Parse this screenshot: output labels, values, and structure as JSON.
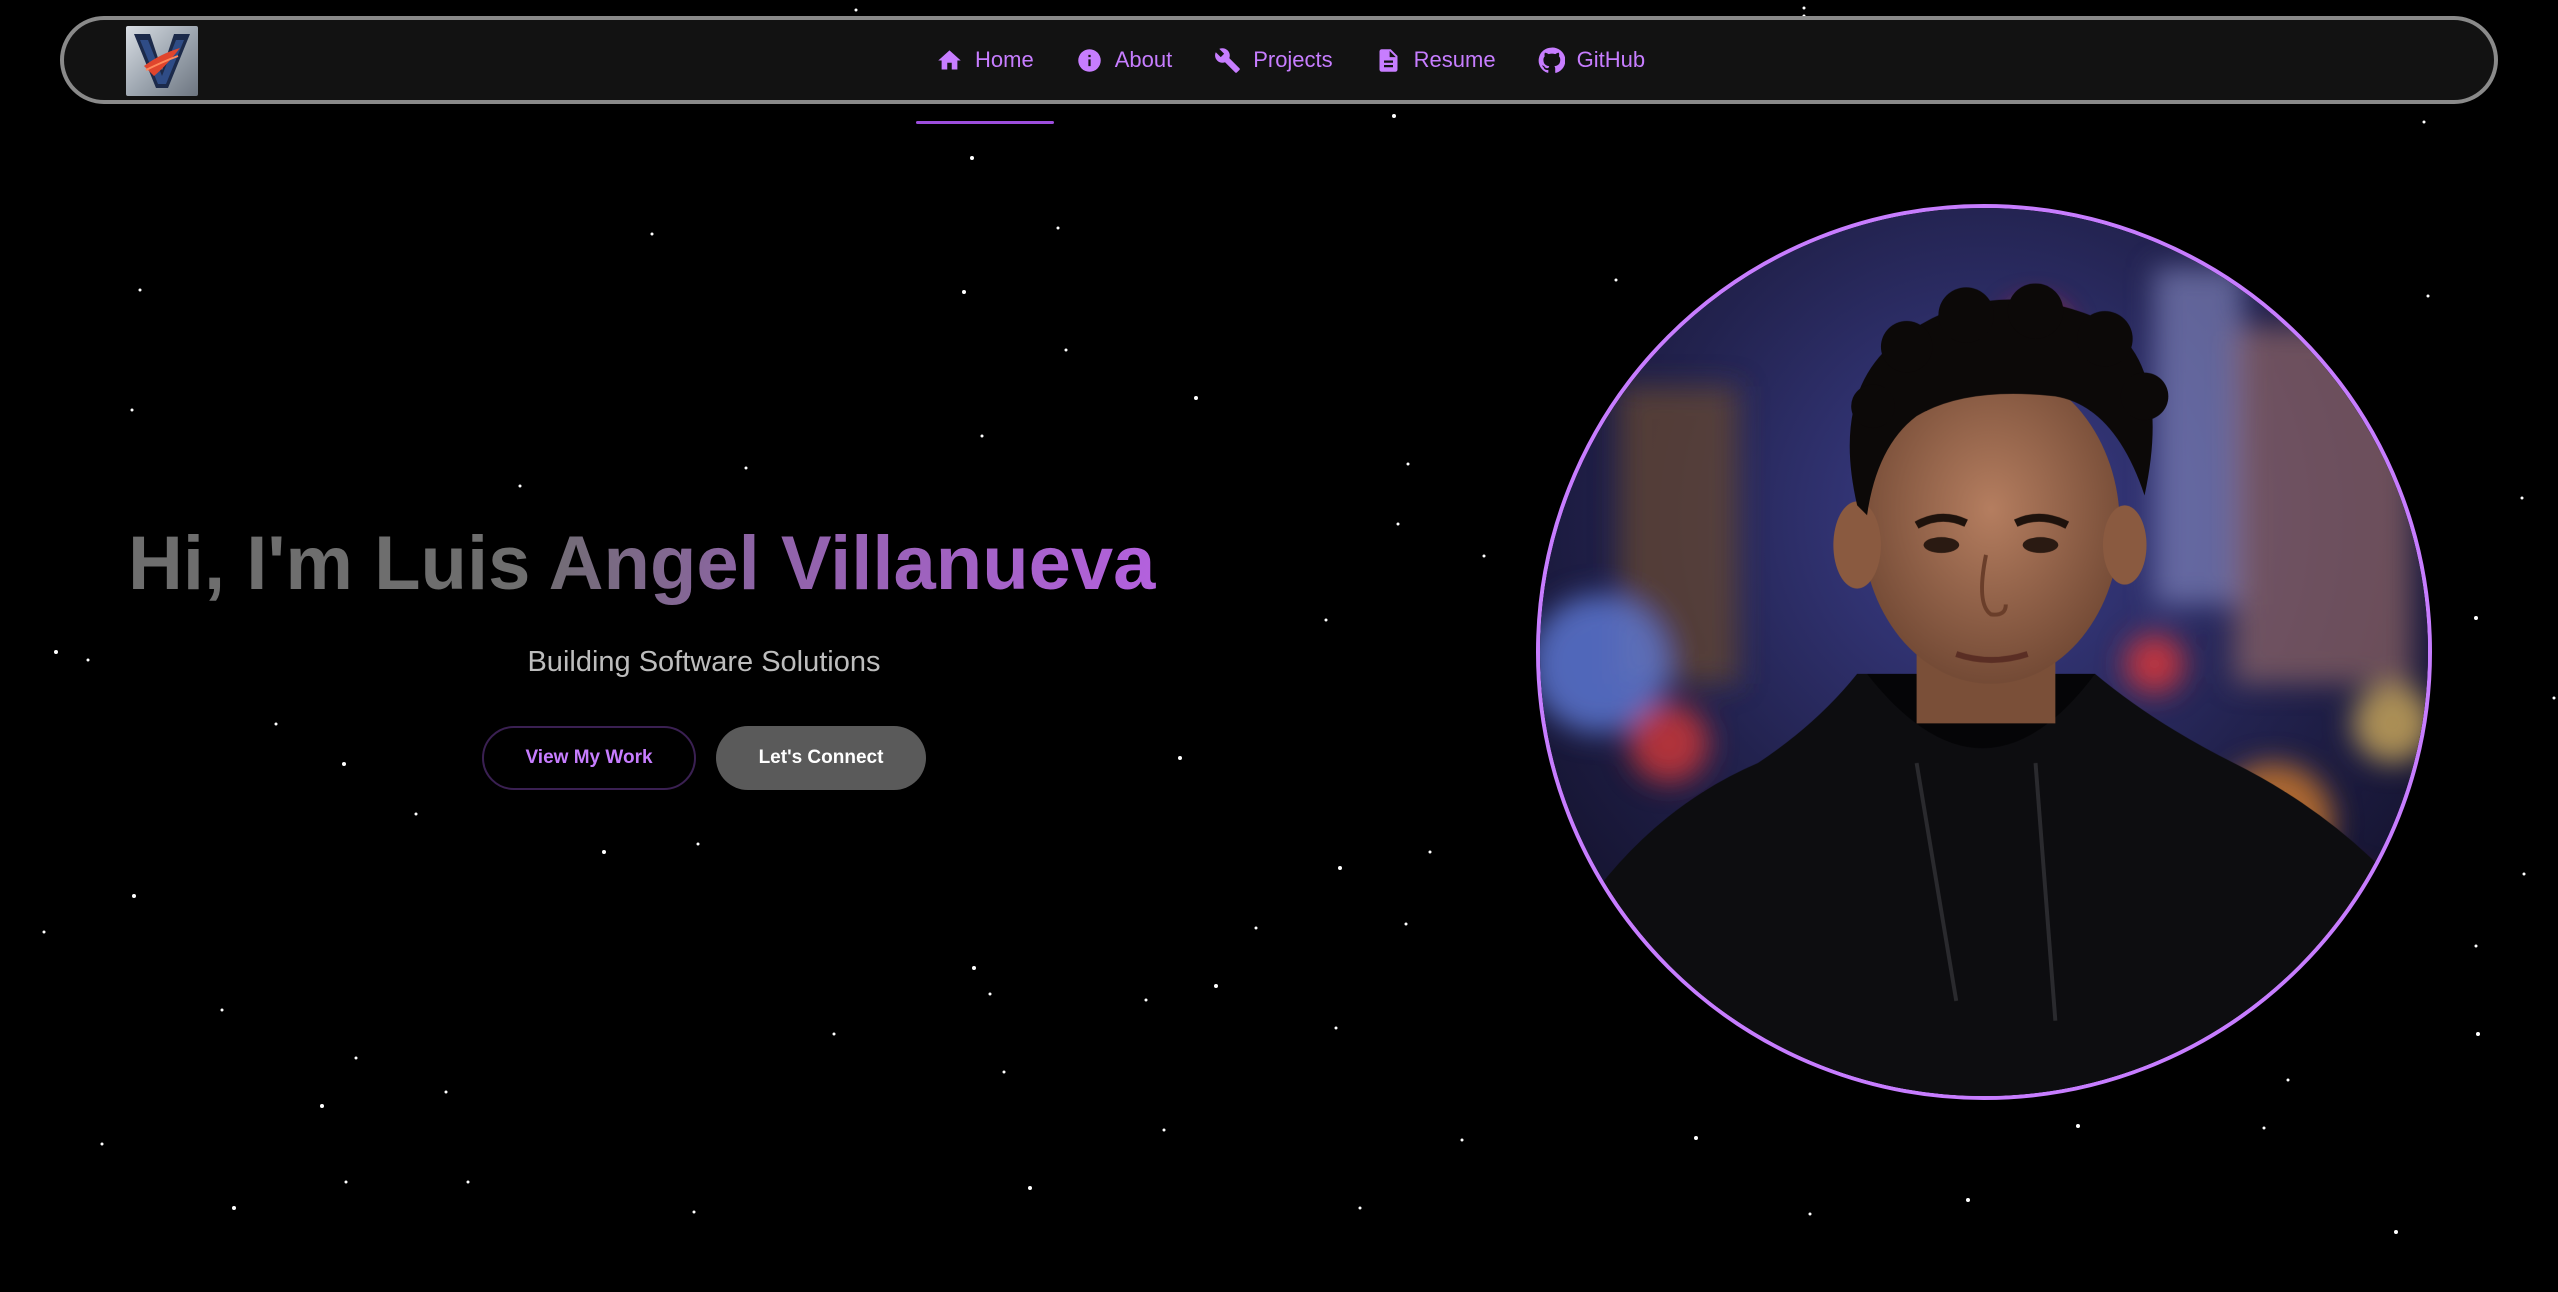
{
  "navbar": {
    "items": [
      {
        "label": "Home",
        "icon": "home-icon",
        "active": true
      },
      {
        "label": "About",
        "icon": "info-icon",
        "active": false
      },
      {
        "label": "Projects",
        "icon": "wrench-icon",
        "active": false
      },
      {
        "label": "Resume",
        "icon": "document-icon",
        "active": false
      },
      {
        "label": "GitHub",
        "icon": "github-icon",
        "active": false
      }
    ]
  },
  "hero": {
    "title": "Hi, I'm Luis Angel Villanueva",
    "subtitle": "Building Software Solutions",
    "primary_button": "View My Work",
    "secondary_button": "Let's Connect"
  },
  "colors": {
    "accent": "#c77dff",
    "background": "#000000",
    "navbar_bg": "#121212",
    "subtitle": "#bdbdbd",
    "button_solid": "#5a5a5a"
  }
}
